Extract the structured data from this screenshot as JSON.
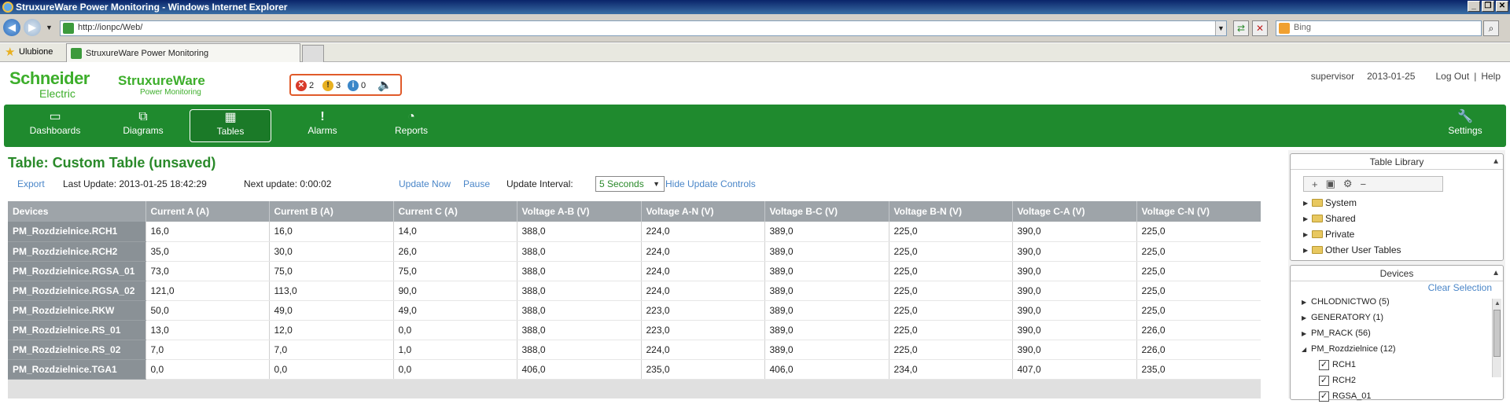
{
  "window": {
    "title": "StruxureWare Power Monitoring - Windows Internet Explorer",
    "buttons": [
      "_",
      "❐",
      "✕"
    ]
  },
  "address": {
    "url": "http://ionpc/Web/",
    "search_placeholder": "Bing"
  },
  "favorites": {
    "label": "Ulubione",
    "tab_title": "StruxureWare Power Monitoring"
  },
  "header": {
    "brand_schneider": "Schneider",
    "brand_electric": "Electric",
    "brand_struxure": "StruxureWare",
    "brand_pm": "Power Monitoring",
    "alarms": {
      "critical": "2",
      "warning": "3",
      "info": "0"
    },
    "user": "supervisor",
    "date": "2013-01-25",
    "logout": "Log Out",
    "separator": "|",
    "help": "Help"
  },
  "nav": {
    "dashboards": "Dashboards",
    "diagrams": "Diagrams",
    "tables": "Tables",
    "alarms": "Alarms",
    "reports": "Reports",
    "settings": "Settings"
  },
  "main": {
    "title": "Table: Custom Table (unsaved)",
    "export": "Export",
    "last_update": "Last Update: 2013-01-25 18:42:29",
    "next_update": "Next update: 0:00:02",
    "update_now": "Update Now",
    "pause": "Pause",
    "interval_label": "Update Interval:",
    "interval_value": "5 Seconds",
    "hide_controls": "Hide Update Controls"
  },
  "table": {
    "columns": [
      "Devices",
      "Current A (A)",
      "Current B (A)",
      "Current C (A)",
      "Voltage A-B (V)",
      "Voltage A-N (V)",
      "Voltage B-C (V)",
      "Voltage B-N (V)",
      "Voltage C-A (V)",
      "Voltage C-N (V)"
    ],
    "rows": [
      [
        "PM_Rozdzielnice.RCH1",
        "16,0",
        "16,0",
        "14,0",
        "388,0",
        "224,0",
        "389,0",
        "225,0",
        "390,0",
        "225,0"
      ],
      [
        "PM_Rozdzielnice.RCH2",
        "35,0",
        "30,0",
        "26,0",
        "388,0",
        "224,0",
        "389,0",
        "225,0",
        "390,0",
        "225,0"
      ],
      [
        "PM_Rozdzielnice.RGSA_01",
        "73,0",
        "75,0",
        "75,0",
        "388,0",
        "224,0",
        "389,0",
        "225,0",
        "390,0",
        "225,0"
      ],
      [
        "PM_Rozdzielnice.RGSA_02",
        "121,0",
        "113,0",
        "90,0",
        "388,0",
        "224,0",
        "389,0",
        "225,0",
        "390,0",
        "225,0"
      ],
      [
        "PM_Rozdzielnice.RKW",
        "50,0",
        "49,0",
        "49,0",
        "388,0",
        "223,0",
        "389,0",
        "225,0",
        "390,0",
        "225,0"
      ],
      [
        "PM_Rozdzielnice.RS_01",
        "13,0",
        "12,0",
        "0,0",
        "388,0",
        "223,0",
        "389,0",
        "225,0",
        "390,0",
        "226,0"
      ],
      [
        "PM_Rozdzielnice.RS_02",
        "7,0",
        "7,0",
        "1,0",
        "388,0",
        "224,0",
        "389,0",
        "225,0",
        "390,0",
        "226,0"
      ],
      [
        "PM_Rozdzielnice.TGA1",
        "0,0",
        "0,0",
        "0,0",
        "406,0",
        "235,0",
        "406,0",
        "234,0",
        "407,0",
        "235,0"
      ]
    ]
  },
  "sidebar": {
    "library_title": "Table Library",
    "library_folders": [
      "System",
      "Shared",
      "Private",
      "Other User Tables"
    ],
    "devices_title": "Devices",
    "clear_selection": "Clear Selection",
    "device_groups": [
      {
        "label": "CHLODNICTWO (5)",
        "expanded": false
      },
      {
        "label": "GENERATORY (1)",
        "expanded": false
      },
      {
        "label": "PM_RACK (56)",
        "expanded": false
      },
      {
        "label": "PM_Rozdzielnice (12)",
        "expanded": true
      }
    ],
    "device_children": [
      "RCH1",
      "RCH2",
      "RGSA_01"
    ]
  },
  "colors": {
    "brand_green": "#3dae2b",
    "nav_green": "#1f8a2e",
    "link_blue": "#4a86c8",
    "header_gray": "#9ea4a9"
  }
}
